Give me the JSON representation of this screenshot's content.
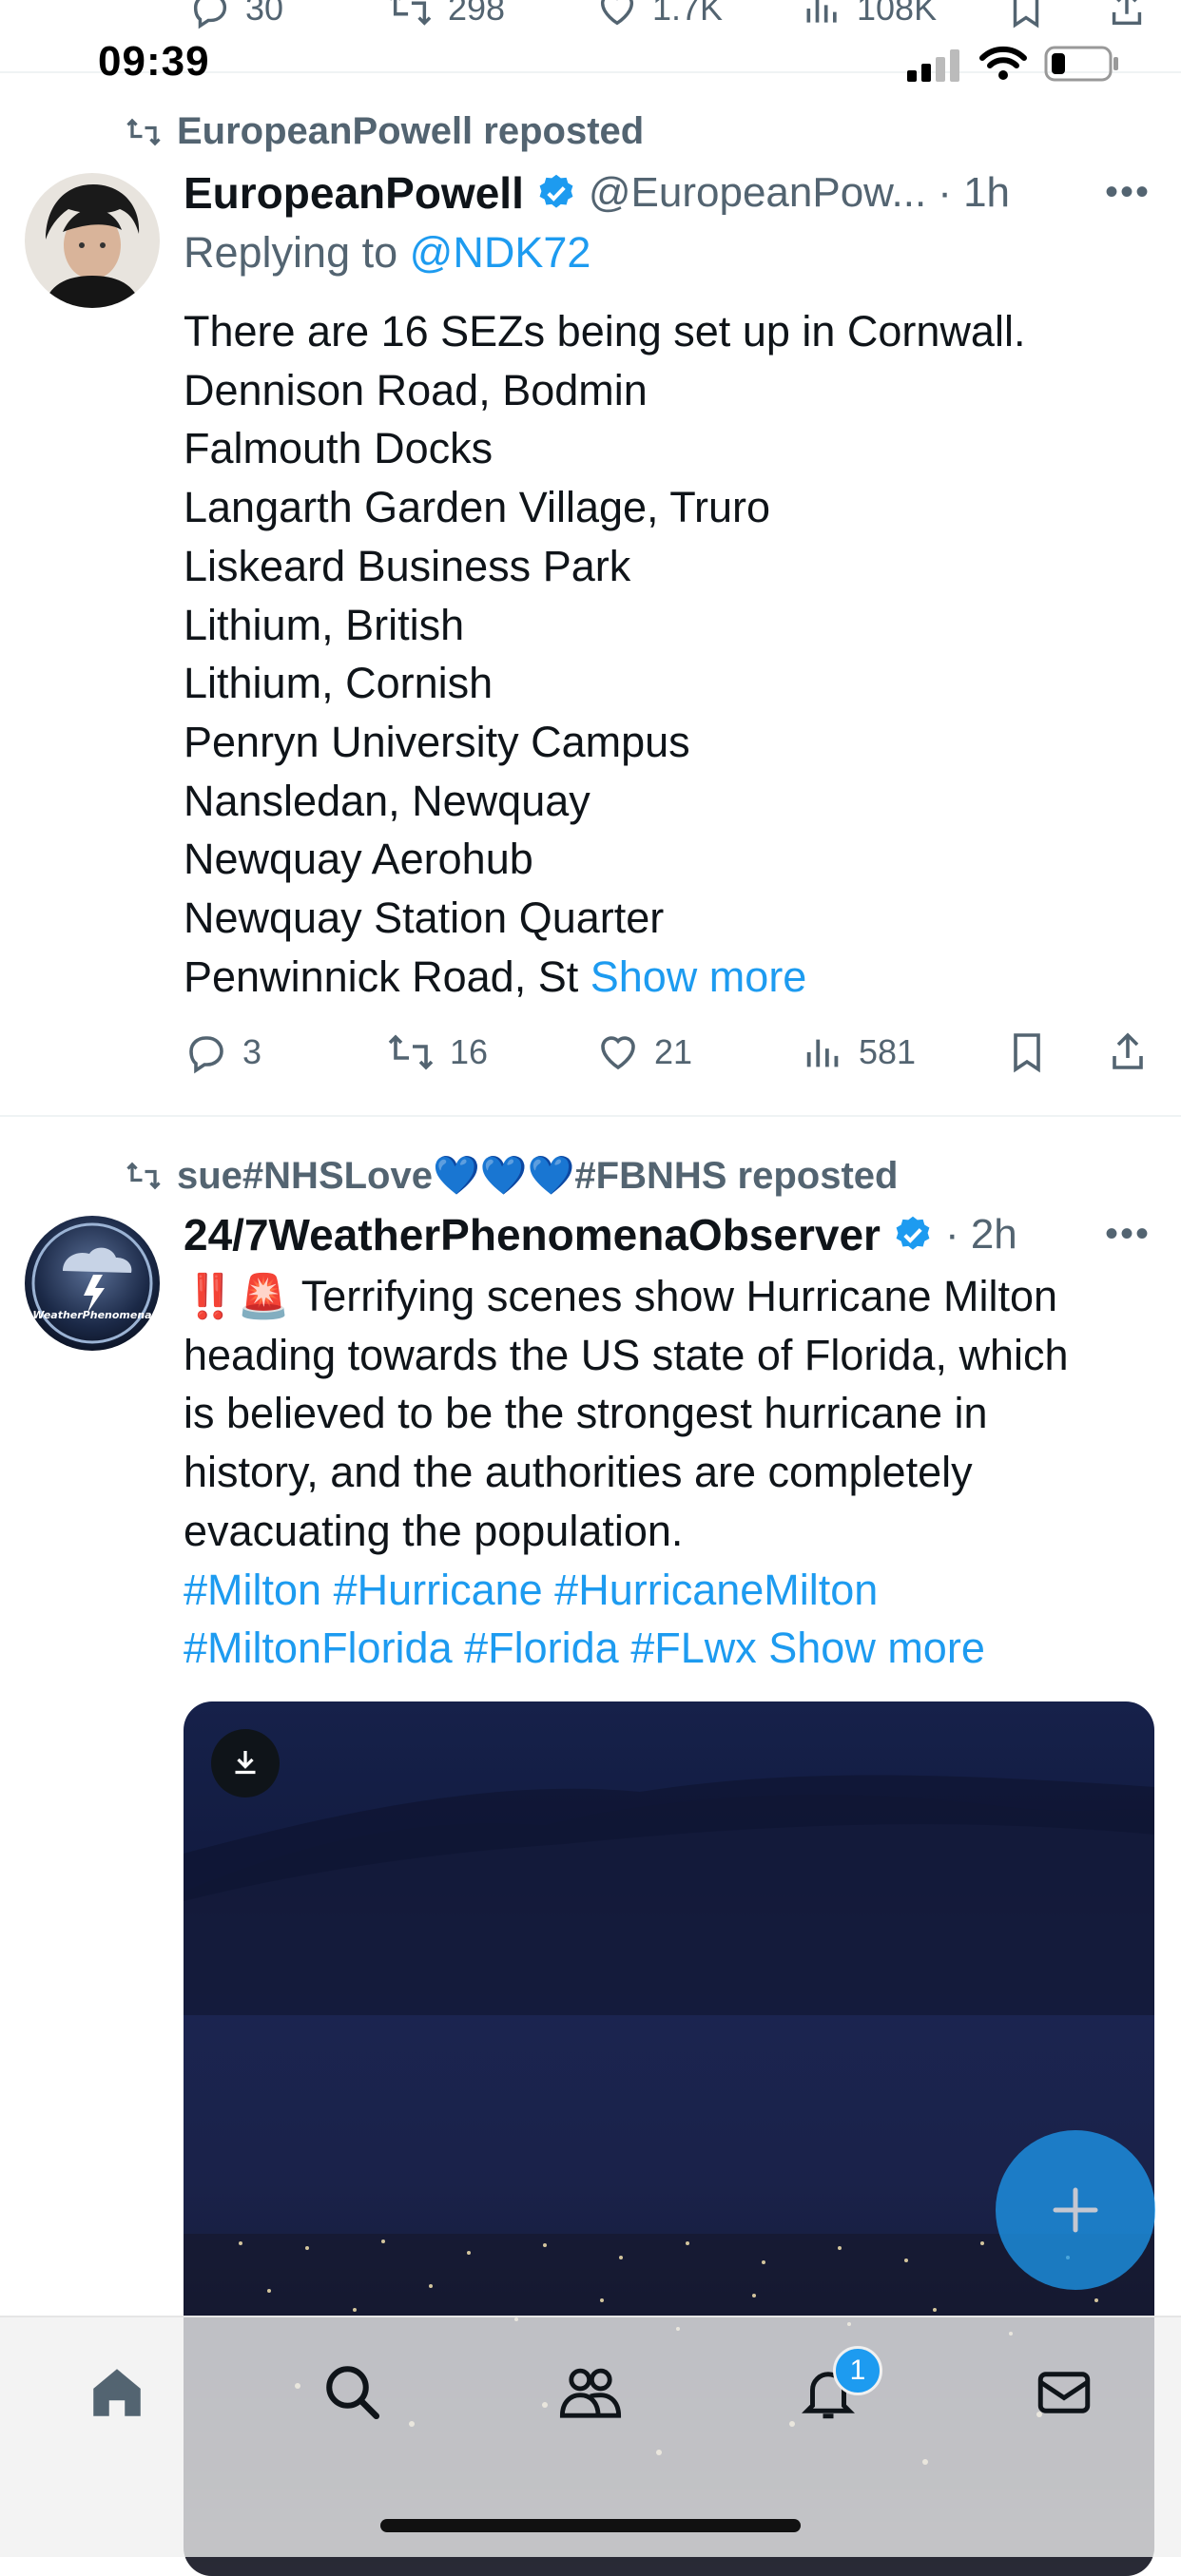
{
  "prev_tweet_actions": {
    "replies": "30",
    "reposts": "298",
    "likes": "1.7K",
    "views": "108K"
  },
  "status_bar": {
    "time": "09:39"
  },
  "tweet1": {
    "reposted_by": "EuropeanPowell reposted",
    "name": "EuropeanPowell",
    "handle": "@EuropeanPow...",
    "time": "· 1h",
    "replying_to_label": "Replying to",
    "replying_to_user": "@NDK72",
    "lines": [
      "There are 16 SEZs being set up in Cornwall.",
      "Dennison Road, Bodmin",
      "Falmouth Docks",
      "Langarth Garden Village, Truro",
      "Liskeard Business Park",
      "Lithium, British",
      "Lithium, Cornish",
      "Penryn University Campus",
      "Nansledan, Newquay",
      "Newquay Aerohub",
      "Newquay Station Quarter"
    ],
    "last_line": "Penwinnick Road, St",
    "show_more": "Show more",
    "replies": "3",
    "reposts": "16",
    "likes": "21",
    "views": "581"
  },
  "tweet2": {
    "reposted_by": "sue#NHSLove💙💙💙#FBNHS reposted",
    "name": "24/7WeatherPhenomenaObserver",
    "time": "· 2h",
    "avatar_text": "WeatherPhenomena",
    "line1_emoji": "‼️🚨",
    "lines": [
      "Terrifying scenes show Hurricane Milton",
      "heading towards the US state of Florida, which",
      "is believed to be the strongest hurricane in",
      "history, and the authorities are completely",
      "evacuating the population."
    ],
    "hashtags_line1": "#Milton #Hurricane #HurricaneMilton",
    "hashtags_line2": "#MiltonFlorida #Florida #FLwx",
    "show_more": "Show more"
  },
  "nav": {
    "notification_badge": "1",
    "items": [
      "home-icon",
      "search-icon",
      "communities-icon",
      "notifications-icon",
      "messages-icon"
    ]
  },
  "colors": {
    "accent": "#1d9bf0",
    "muted": "#536471",
    "text": "#0f1419"
  }
}
